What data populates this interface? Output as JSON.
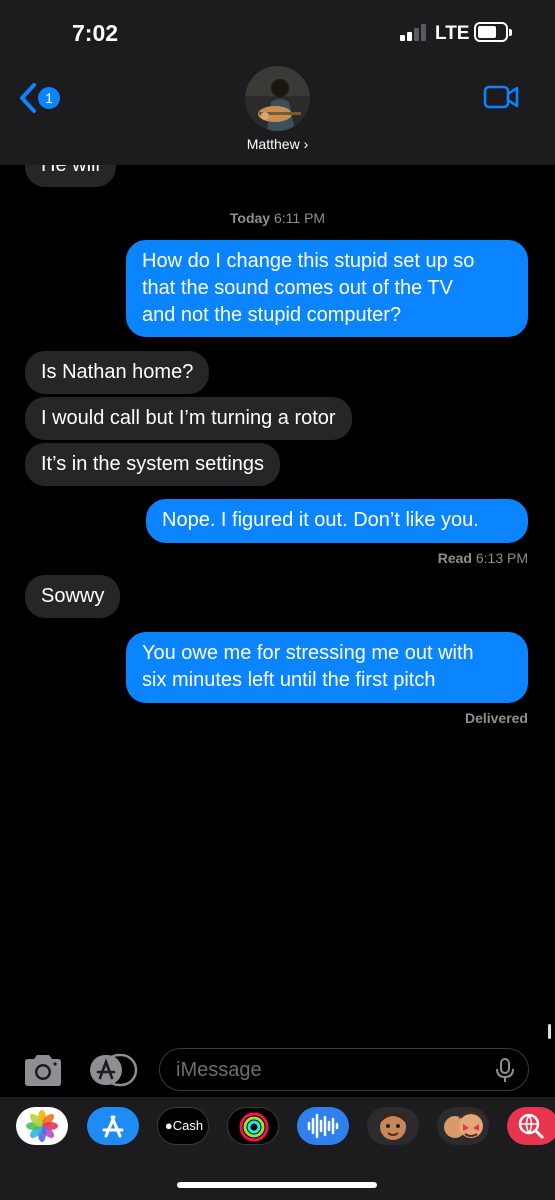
{
  "status_bar": {
    "time": "7:02",
    "network": "LTE",
    "signal_bars": 2,
    "battery_level": 0.7
  },
  "header": {
    "back_badge": "1",
    "contact_name": "Matthew ›",
    "accent": "#0a84ff"
  },
  "conversation": {
    "partial_message": "He will",
    "timestamp_day": "Today",
    "timestamp_time": "6:11 PM",
    "messages": [
      {
        "from": "me",
        "lines": [
          "How do I change this stupid set up so",
          "that the sound comes out of the TV",
          "and not the stupid computer?"
        ]
      },
      {
        "from": "them",
        "text": "Is Nathan home?"
      },
      {
        "from": "them",
        "text": "I would call but I’m turning a rotor"
      },
      {
        "from": "them",
        "text": "It’s in the system settings"
      },
      {
        "from": "me",
        "text": "Nope. I figured it out. Don’t like you."
      },
      {
        "from": "them",
        "text": "Sowwy"
      },
      {
        "from": "me",
        "lines": [
          "You owe me for stressing me out with",
          "six minutes left until the first pitch"
        ]
      }
    ],
    "read_label": "Read",
    "read_time": "6:13 PM",
    "delivered_label": "Delivered"
  },
  "composer": {
    "placeholder": "iMessage"
  },
  "app_drawer": {
    "apps": [
      {
        "name": "photos-app-icon"
      },
      {
        "name": "app-store-icon"
      },
      {
        "name": "apple-cash-icon",
        "label": "Cash"
      },
      {
        "name": "activity-icon"
      },
      {
        "name": "audio-message-icon"
      },
      {
        "name": "memoji-icon"
      },
      {
        "name": "memoji-stickers-icon"
      },
      {
        "name": "web-images-icon"
      }
    ]
  },
  "colors": {
    "incoming_bubble": "#262628",
    "outgoing_bubble": "#0a84ff",
    "background": "#000000",
    "header": "#1c1c1e"
  }
}
